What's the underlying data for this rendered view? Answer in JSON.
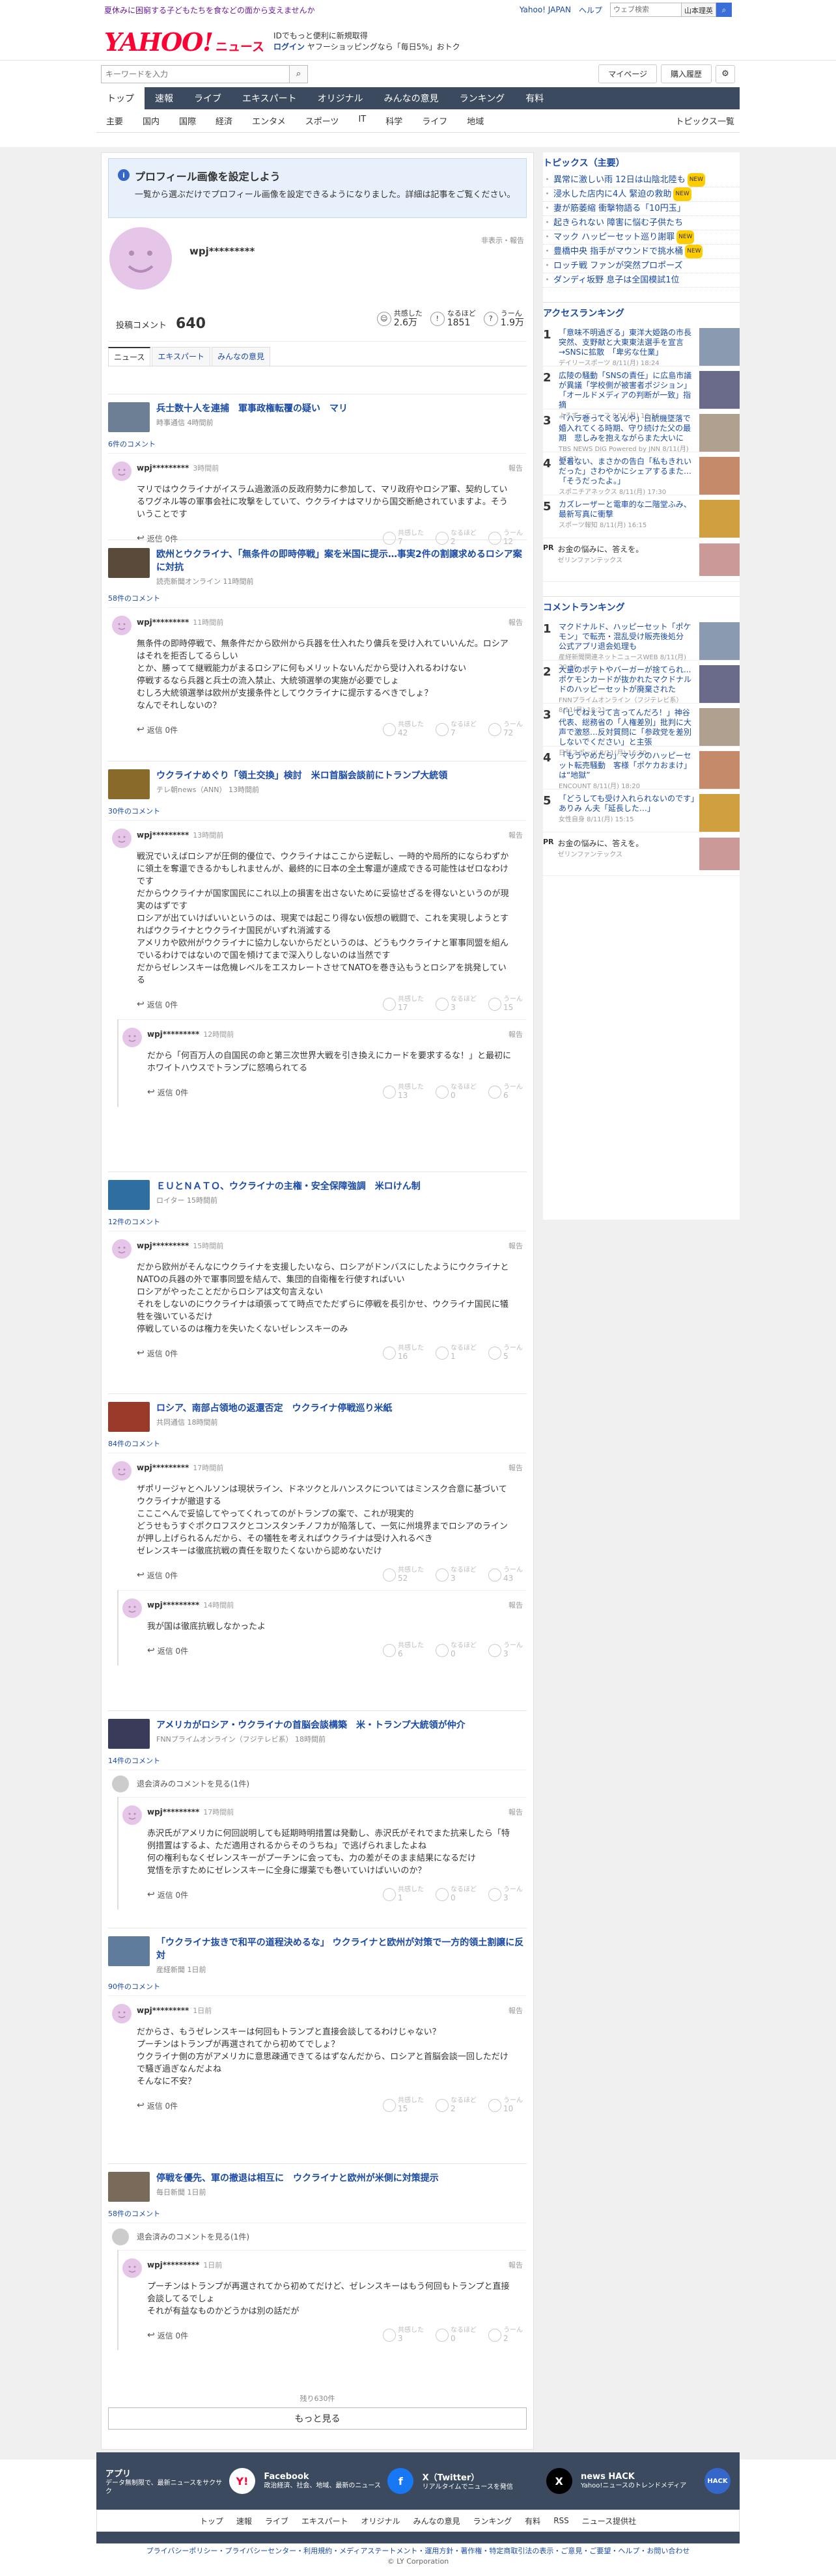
{
  "top": {
    "promo": "夏休みに困窮する子どもたちを食などの面から支えませんか",
    "yahoo_japan": "Yahoo! JAPAN",
    "help": "ヘルプ",
    "search_placeholder": "ウェブ検索",
    "search_scope": "山本理英"
  },
  "header": {
    "logo_main": "YAHOO!",
    "logo_sub": "ニュース",
    "msg1": "IDでもっと便利に新規取得",
    "msg_login": "ログイン",
    "msg2": "ヤフーショッピングなら「毎日5%」おトク",
    "search_placeholder": "キーワードを入力",
    "mypage": "マイページ",
    "purchase": "購入履歴"
  },
  "gnav": [
    "トップ",
    "速報",
    "ライブ",
    "エキスパート",
    "オリジナル",
    "みんなの意見",
    "ランキング",
    "有料"
  ],
  "topics_nav": {
    "items": [
      "主要",
      "国内",
      "国際",
      "経済",
      "エンタメ",
      "スポーツ",
      "IT",
      "科学",
      "ライフ",
      "地域"
    ],
    "all": "トピックス一覧"
  },
  "notice": {
    "title": "プロフィール画像を設定しよう",
    "desc": "一覧から選ぶだけでプロフィール画像を設定できるようになりました。詳細は記事をご覧ください。"
  },
  "profile": {
    "name": "wpj*********",
    "report": "非表示・報告",
    "count_label": "投稿コメント",
    "count": "640",
    "reactions": [
      {
        "label": "共感した",
        "value": "2.6万"
      },
      {
        "label": "なるほど",
        "value": "1851"
      },
      {
        "label": "うーん",
        "value": "1.9万"
      }
    ]
  },
  "tabs": [
    "ニュース",
    "エキスパート",
    "みんなの意見"
  ],
  "articles": [
    {
      "title": "兵士数十人を連捕　軍事政権転覆の疑い　マリ",
      "source": "時事通信 4時間前",
      "comments": "6件のコメント",
      "items": [
        {
          "user": "wpj*********",
          "time": "3時間前",
          "body": "マリではウクライナがイスラム過激派の反政府勢力に参加して、マリ政府やロシア軍、契約しているワグネル等の軍事会社に攻撃をしていて、ウクライナはマリから国交断絶されていますよ。そういうことです",
          "nums": [
            "7",
            "2",
            "12"
          ]
        }
      ]
    },
    {
      "title": "欧州とウクライナ、「無条件の即時停戦」案を米国に提示…事実2件の割譲求めるロシア案に対抗",
      "source": "読売新聞オンライン 11時間前",
      "comments": "58件のコメント",
      "items": [
        {
          "user": "wpj*********",
          "time": "11時間前",
          "body": "無条件の即時停戦で、無条件だから欧州から兵器を仕入れたり傭兵を受け入れていいんだ。ロシアはそれを拒否してるらしい\nとか、勝ってて継戦能力がまるロシアに何もメリットないんだから受け入れるわけない\n停戦するなら兵器と兵士の流入禁止、大統領選挙の実施が必要でしょ\nむしろ大統領選挙は欧州が支援条件としてウクライナに提示するべきでしょ？\nなんでそれしないの？",
          "nums": [
            "42",
            "7",
            "72"
          ]
        }
      ]
    },
    {
      "title": "ウクライナめぐり「領土交換」検討　米ロ首脳会談前にトランプ大統領",
      "source": "テレ朝news（ANN） 13時間前",
      "comments": "30件のコメント",
      "items": [
        {
          "user": "wpj*********",
          "time": "13時間前",
          "body": "戦況でいえばロシアが圧倒的優位で、ウクライナはここから逆転し、一時的や局所的にならわずかに領土を奪還できるかもしれませんが、最終的に日本の全土奪還が達成できる可能性はゼロなわけです\nだからウクライナが国家国民にこれ以上の損害を出さないために妥協せざるを得ないというのが現実のはずです\nロシアが出ていけばいいというのは、現実では起こり得ない仮想の戦闘で、これを実現しようとすればウクライナとウクライナ国民がいずれ消滅する\nアメリカや欧州がウクライナに協力しないからだというのは、どうもウクライナと軍事同盟を組んでいるわけではないので国を傾けてまで深入りしないのは当然です\nだからゼレンスキーは危機レベルをエスカレートさせてNATOを巻き込もうとロシアを挑発している",
          "nums": [
            "17",
            "3",
            "15"
          ]
        },
        {
          "user": "wpj*********",
          "time": "12時間前",
          "body": "だから「何百万人の自国民の命と第三次世界大戦を引き換えにカードを要求するな！」と最初にホワイトハウスでトランプに怒鳴られてる",
          "nums": [
            "13",
            "0",
            "6"
          ],
          "reply": true
        }
      ]
    },
    {
      "title": "ＥＵとＮＡＴＯ、ウクライナの主権・安全保障強調　米ロけん制",
      "source": "ロイター 15時間前",
      "comments": "12件のコメント",
      "items": [
        {
          "user": "wpj*********",
          "time": "15時間前",
          "body": "だから欧州がそんなにウクライナを支援したいなら、ロシアがドンバスにしたようにウクライナとNATOの兵器の外で軍事同盟を結んで、集団的自衛権を行使すればいい\nロシアがやったことだからロシアは文句言えない\nそれをしないのにウクライナは頑張ってて時点でただずらに停戦を長引かせ、ウクライナ国民に犠牲を強いているだけ\n停戦しているのは権力を失いたくないゼレンスキーのみ",
          "nums": [
            "16",
            "1",
            "5"
          ]
        }
      ]
    },
    {
      "title": "ロシア、南部占領地の返還否定　ウクライナ停戦巡り米紙",
      "source": "共同通信 18時間前",
      "comments": "84件のコメント",
      "items": [
        {
          "user": "wpj*********",
          "time": "17時間前",
          "body": "ザポリージャとヘルソンは現状ライン、ドネツクとルハンスクについてはミンスク合意に基づいてウクライナが撤退する\nこここへんで妥協してやってくれってのがトランプの案で、これが現実的\nどうせもうすぐポクロフスクとコンスタンチノフカが陥落して、一気に州境界までロシアのラインが押し上げられるんだから、その犠牲を考えればウクライナは受け入れるべき\nゼレンスキーは徹底抗戦の責任を取りたくないから認めないだけ",
          "nums": [
            "52",
            "3",
            "43"
          ]
        },
        {
          "user": "wpj*********",
          "time": "14時間前",
          "body": "我が国は徹底抗戦しなかったよ",
          "nums": [
            "6",
            "0",
            "3"
          ],
          "reply": true
        }
      ]
    },
    {
      "title": "アメリカがロシア・ウクライナの首脳会談構築　米・トランプ大統領が仲介",
      "source": "FNNプライムオンライン（フジテレビ系） 18時間前",
      "comments": "14件のコメント",
      "deleted": "退会済みのコメントを見る(1件)",
      "items": [
        {
          "user": "wpj*********",
          "time": "17時間前",
          "body": "赤沢氏がアメリカに何回説明しても延期時明措置は発動し、赤沢氏がそれでまた抗来したら「特例措置はするよ、ただ適用されるからそのうちね」で逃げられましたよね\n何の権利もなくゼレンスキーがプーチンに会っても、力の差がそのまま結果になるだけ\n覚悟を示すためにゼレンスキーに全身に爆薬でも巻いていけばいいのか？",
          "nums": [
            "1",
            "0",
            "3"
          ],
          "reply": true
        }
      ]
    },
    {
      "title": "「ウクライナ抜きで和平の道程決めるな」 ウクライナと欧州が対策で一方的領土割譲に反対",
      "source": "産経新聞 1日前",
      "comments": "90件のコメント",
      "items": [
        {
          "user": "wpj*********",
          "time": "1日前",
          "body": "だからさ、もうゼレンスキーは何回もトランプと直接会談してるわけじゃない？\nプーチンはトランプが再選されてから初めてでしょ？\nウクライナ側の方がアメリカに意思疎通できてるはずなんだから、ロシアと首脳会談一回しただけで騒ぎ過ぎなんだよね\nそんなに不安？",
          "nums": [
            "15",
            "2",
            "10"
          ]
        }
      ]
    },
    {
      "title": "停戦を優先、軍の撤退は相互に　ウクライナと欧州が米側に対策提示",
      "source": "毎日新聞 1日前",
      "comments": "58件のコメント",
      "deleted": "退会済みのコメントを見る(1件)",
      "items": [
        {
          "user": "wpj*********",
          "time": "1日前",
          "body": "プーチンはトランプが再選されてから初めてだけど、ゼレンスキーはもう何回もトランプと直接会談してるでしょ\nそれが有益なものかどうかは別の話だが",
          "nums": [
            "3",
            "0",
            "2"
          ],
          "reply": true
        }
      ]
    }
  ],
  "labels": {
    "retweet": "返信 0件",
    "report": "報告",
    "r1": "共感した",
    "r2": "なるほど",
    "r3": "うーん"
  },
  "more": {
    "remaining": "残り630件",
    "button": "もっと見る"
  },
  "side": {
    "topics_title": "トピックス（主要）",
    "topics": [
      {
        "t": "異常に激しい雨 12日は山陰北陸も",
        "b": "NEW"
      },
      {
        "t": "浸水した店内に4人 緊迫の救助",
        "b": "NEW"
      },
      {
        "t": "妻が筋萎縮 衝撃物語る「10円玉」",
        "b": ""
      },
      {
        "t": "起きられない 障害に悩む子供たち",
        "b": ""
      },
      {
        "t": "マック ハッピーセット巡り謝罪",
        "b": "NEW"
      },
      {
        "t": "豊橋中央 指手がマウンドで挑水桶",
        "b": "NEW"
      },
      {
        "t": "ロッチ戦 ファンが突然プロポーズ",
        "b": ""
      },
      {
        "t": "ダンディ坂野 息子は全国模試1位",
        "b": ""
      }
    ],
    "access_title": "アクセスランキング",
    "access": [
      {
        "t": "「意味不明過ぎる」東洋大姫路の市長　突然、支野献と大東東法選手を宣言→SNSに拡散　「卑劣な仕業」",
        "s": "デイリースポーツ 8/11(月) 18:24"
      },
      {
        "t": "広陵の騒動「SNSの責任」に広島市議が異議「学校側が被害者ポジション」「オールドメディアの判断が一致」指摘",
        "s": "よろず〜ニュース 8/11(月) 18:56"
      },
      {
        "t": "「ハラ巻ってくるんや」日航機墜落で婚入れてくる時期、守り続けた父の最期　悲しみを抱えながらまた大いに",
        "s": "TBS NEWS DIG Powered by JNN 8/11(月) 17:01"
      },
      {
        "t": "愛着ない、まさかの告白「私もきれいだった」さわやかにシェアするまた…「そうだったよ。」",
        "s": "スポニチアネックス 8/11(月) 17:30"
      },
      {
        "t": "カズレーザーと電車的な二階堂ふみ、最新写真に衝撃",
        "s": "スポーツ報知 8/11(月) 16:15"
      }
    ],
    "pr1": {
      "tag": "PR",
      "t": "お金の悩みに、答えを。",
      "s": "ゼリンファンテックス"
    },
    "comment_title": "コメントランキング",
    "comment_rank": [
      {
        "t": "マクドナルド、ハッピーセット「ポケモン」で転売・混乱受け販売後処分　公式アプリ退会処理も",
        "s": "産経新聞関連ネットニュースWEB 8/11(月) 20:36"
      },
      {
        "t": "大量のポテトやバーガーが捨てられ...ポケモンカードが抜かれたマクドナルドのハッピーセットが廃棄された",
        "s": "FNNプライムオンライン（フジテレビ系） 8/11(月) 18:21"
      },
      {
        "t": "「してねぇって言ってんだろ！」神谷代表、総務省の「人権差別」批判に大声で激怒…反対質問に「参政党を差別しないでください」と主張",
        "s": "日刊スポーツ 8/11(月) 16:30"
      },
      {
        "t": "「もうやめたら」マックのハッピーセット転売騒動　客様「ポケカおまけ」は“地獄”",
        "s": "ENCOUNT 8/11(月) 18:20"
      },
      {
        "t": "「どうしても受け入れられないのです」ありみ ん夫「延長した…」",
        "s": "女性自身 8/11(月) 15:15"
      }
    ],
    "pr2": {
      "tag": "PR",
      "t": "お金の悩みに、答えを。",
      "s": "ゼリンファンテックス"
    },
    "ad_label": "広告"
  },
  "footer": {
    "apps": [
      {
        "t": "アプリ",
        "d": "データ無制限で、最新ニュースをサクサク",
        "ic": "Y!"
      },
      {
        "t": "Facebook",
        "d": "政治経済、社会、地域、最新のニュース",
        "ic": "f"
      },
      {
        "t": "X（Twitter）",
        "d": "リアルタイムでニュースを発信",
        "ic": "X"
      },
      {
        "t": "news HACK",
        "d": "Yahoo!ニュースのトレンドメディア",
        "ic": "HACK"
      }
    ],
    "links": [
      "トップ",
      "速報",
      "ライブ",
      "エキスパート",
      "オリジナル",
      "みんなの意見",
      "ランキング",
      "有料",
      "RSS",
      "ニュース提供社"
    ],
    "legal": "プライバシーポリシー・プライバシーセンター・利用規約・メディアステートメント・運用方針・著作権・特定商取引法の表示・ご意見・ご要望・ヘルプ・お問い合わせ",
    "copy": "© LY Corporation"
  }
}
